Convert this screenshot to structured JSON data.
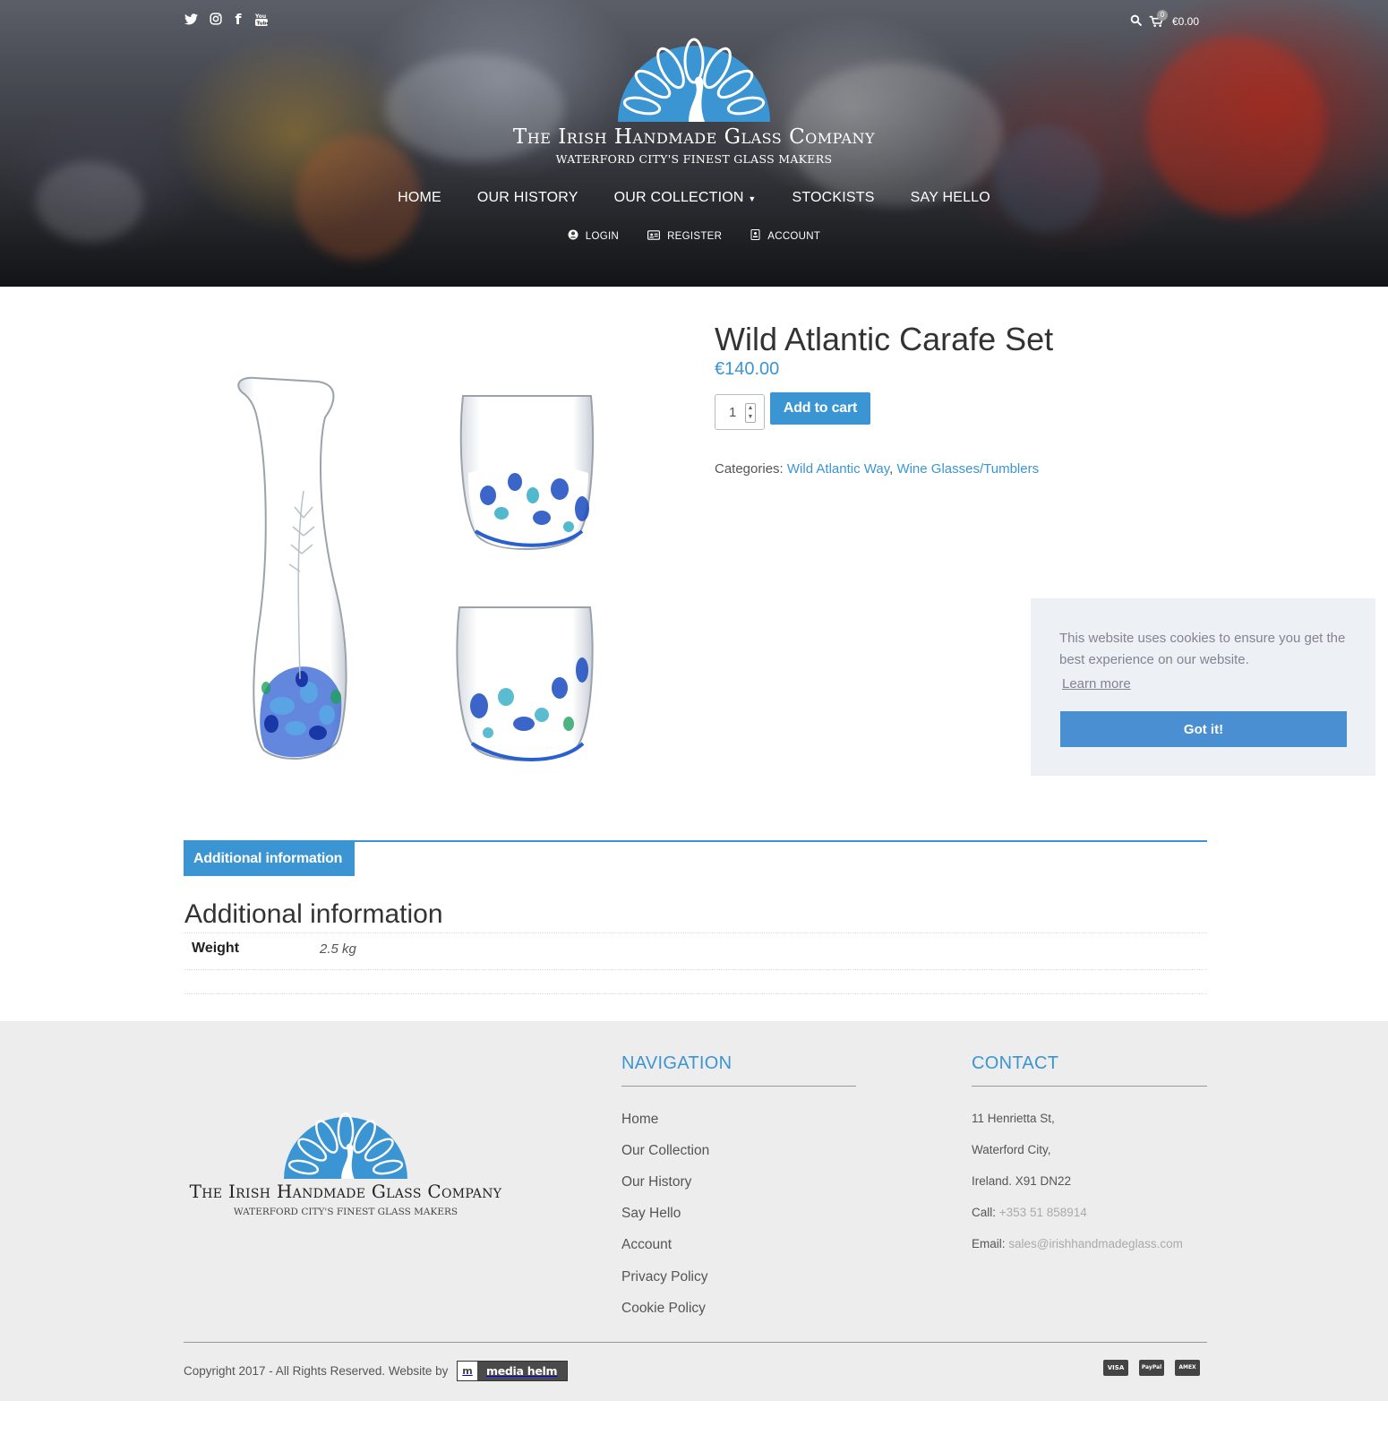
{
  "header": {
    "social": [
      {
        "name": "twitter-icon",
        "glyph": "🐦"
      },
      {
        "name": "instagram-icon",
        "glyph": "◎"
      },
      {
        "name": "facebook-icon",
        "glyph": "f"
      },
      {
        "name": "youtube-icon",
        "glyph": "▶"
      }
    ],
    "brand_title": "The Irish Handmade Glass Company",
    "brand_subtitle": "WATERFORD CITY'S FINEST GLASS MAKERS",
    "cart": {
      "count": "0",
      "total": "€0.00"
    },
    "nav": [
      "HOME",
      "OUR HISTORY",
      "OUR COLLECTION",
      "STOCKISTS",
      "SAY HELLO"
    ],
    "account_nav": [
      "LOGIN",
      "REGISTER",
      "ACCOUNT"
    ]
  },
  "product": {
    "title": "Wild Atlantic Carafe Set",
    "price": "€140.00",
    "quantity": "1",
    "add_to_cart_label": "Add to cart",
    "categories_label": "Categories:",
    "categories": [
      "Wild Atlantic Way",
      "Wine Glasses/Tumblers"
    ],
    "categories_sep": ", "
  },
  "cookie": {
    "message": "This website uses cookies to ensure you get the best experience on our website.",
    "learn_more": "Learn more",
    "accept": "Got it!"
  },
  "tabs": {
    "active_label": "Additional information",
    "heading": "Additional information",
    "attributes": [
      {
        "label": "Weight",
        "value": "2.5 kg"
      }
    ]
  },
  "footer": {
    "brand_title": "The Irish Handmade Glass Company",
    "brand_subtitle": "WATERFORD CITY'S FINEST GLASS MAKERS",
    "nav_heading": "NAVIGATION",
    "nav_links": [
      "Home",
      "Our Collection",
      "Our History",
      "Say Hello",
      "Account",
      "Privacy Policy",
      "Cookie Policy"
    ],
    "contact_heading": "CONTACT",
    "address": [
      "11 Henrietta St,",
      "Waterford City,",
      "Ireland. X91 DN22"
    ],
    "call_label": "Call:",
    "phone": "+353 51 858914",
    "email_label": "Email:",
    "email": "sales@irishhandmadeglass.com",
    "copyright": "Copyright 2017 - All Rights Reserved. Website by",
    "media_helm": "media helm",
    "payments": [
      "VISA",
      "PayPal",
      "AMEX"
    ]
  },
  "colors": {
    "accent": "#3b95d3",
    "footer_bg": "#ededed",
    "cookie_bg": "#edf0f5",
    "cookie_button": "#4b8fd3"
  }
}
